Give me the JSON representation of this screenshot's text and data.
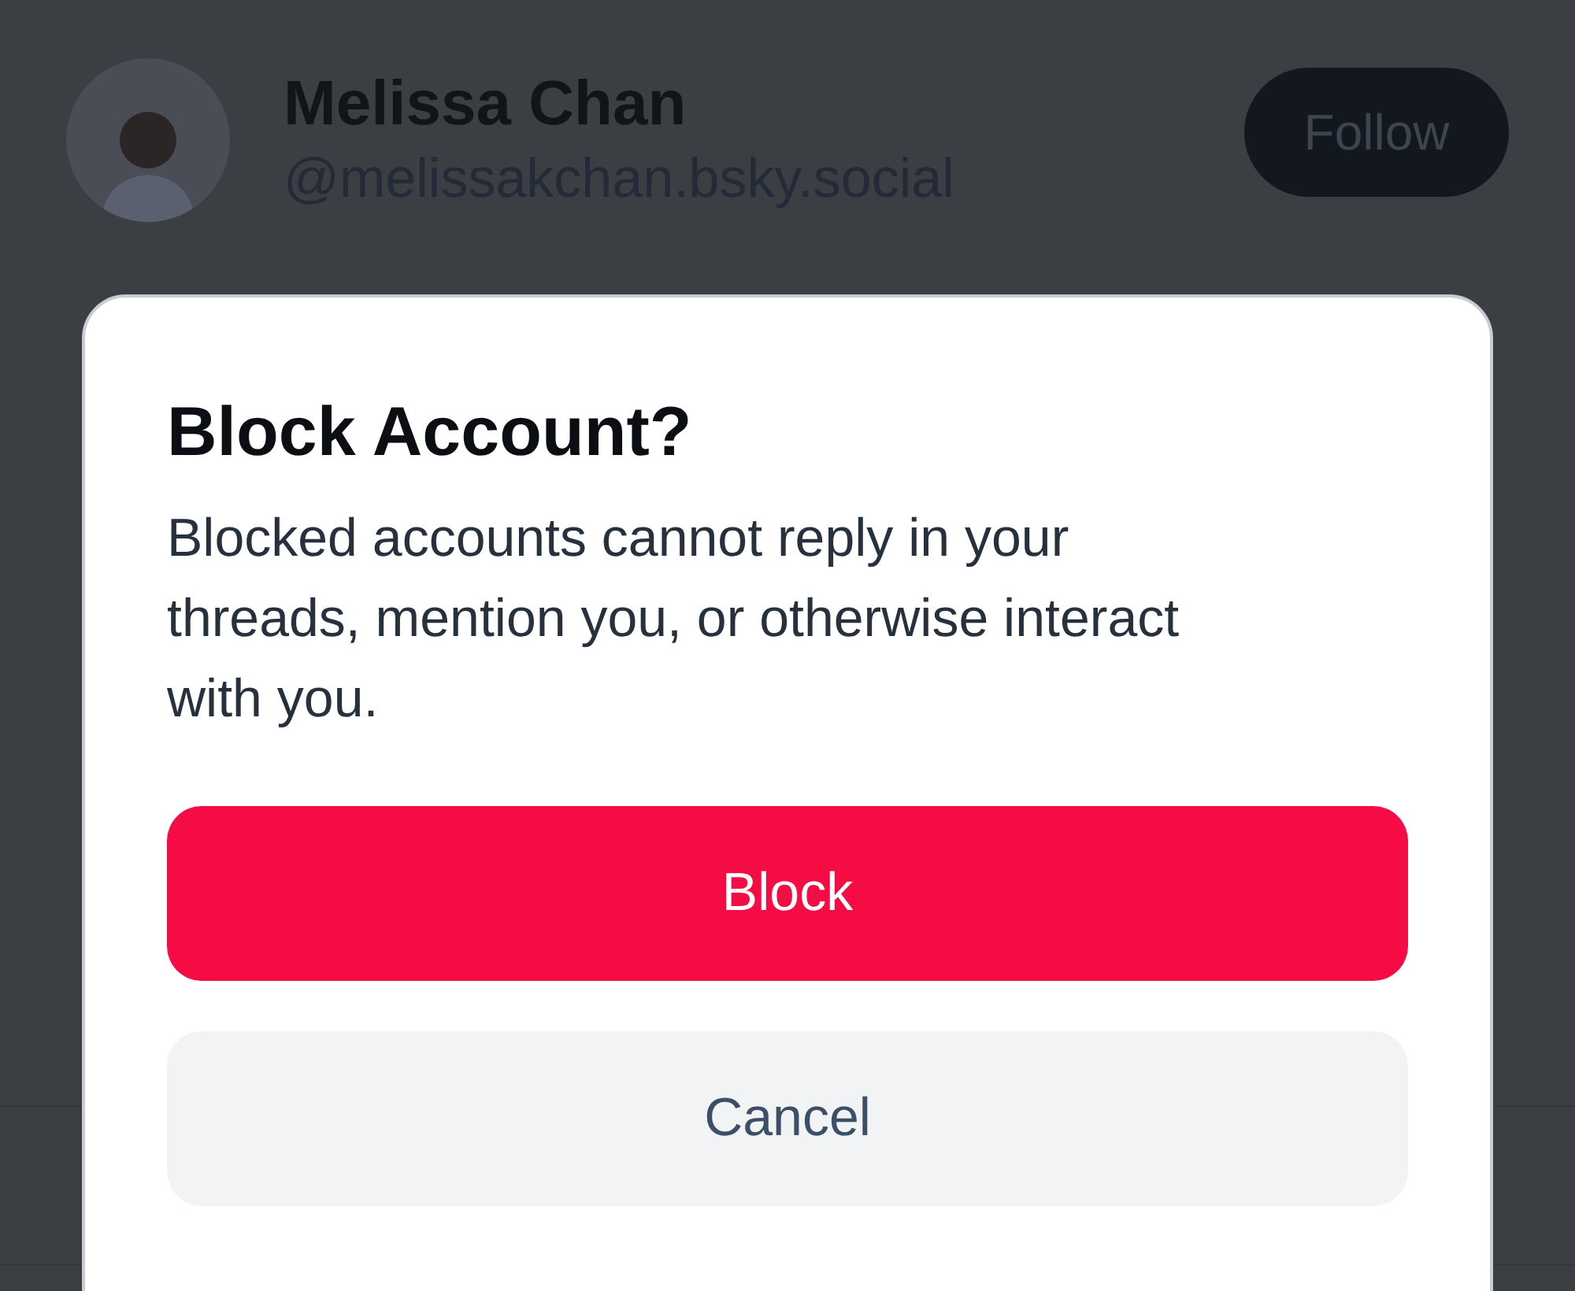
{
  "profile": {
    "name": "Melissa Chan",
    "handle": "@melissakchan.bsky.social",
    "follow_button": "Follow"
  },
  "dialog": {
    "title": "Block Account?",
    "message": "Blocked accounts cannot reply in your threads, mention you, or otherwise interact with you.",
    "buttons": [
      {
        "label": "Block",
        "kind": "danger"
      },
      {
        "label": "Cancel",
        "kind": "secondary"
      }
    ]
  }
}
